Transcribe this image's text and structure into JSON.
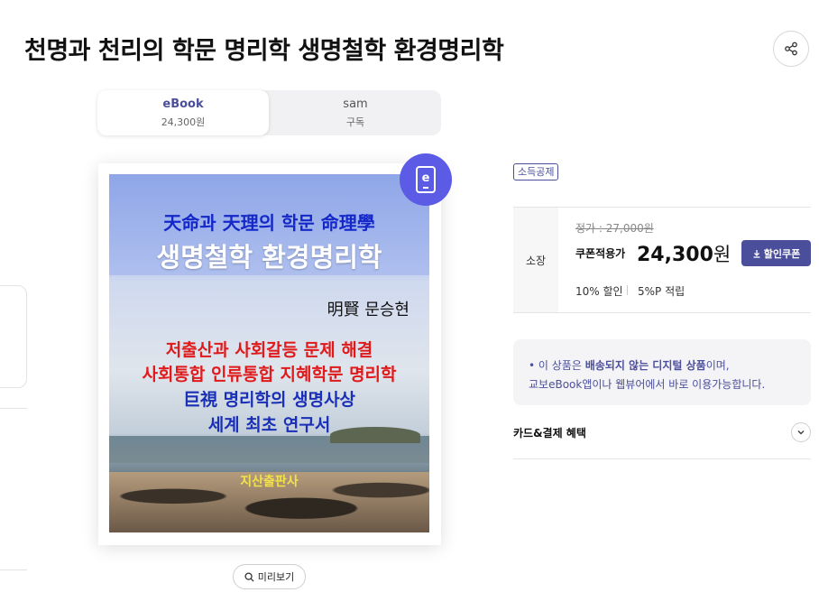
{
  "title": "천명과 천리의 학문 명리학 생명철학 환경명리학",
  "tabs": [
    {
      "name": "eBook",
      "sub": "24,300원"
    },
    {
      "name": "sam",
      "sub": "구독"
    }
  ],
  "cover": {
    "line1": "天命과 天理의 학문 命理學",
    "line2": "생명철학 환경명리학",
    "author": "明賢 문승현",
    "line4": "저출산과 사회갈등 문제 해결",
    "line5": "사회통합 인류통합 지혜학문 명리학",
    "line6": "巨視 명리학의 생명사상",
    "line7": "세계 최초 연구서",
    "publisher": "지산출판사",
    "badge_letter": "e"
  },
  "preview_label": "미리보기",
  "deduction_badge": "소득공제",
  "price": {
    "row_label": "소장",
    "list_price": "정가 : 27,000원",
    "coupon_label": "쿠폰적용가",
    "sale_amount": "24,300",
    "sale_unit": "원",
    "coupon_button": "할인쿠폰",
    "discount": "10% 할인",
    "points": "5%P 적립"
  },
  "notice": {
    "prefix": "이 상품은 ",
    "highlight": "배송되지 않는 디지털 상품",
    "suffix": "이며,",
    "line2": "교보eBook앱이나 웹뷰어에서 바로 이용가능합니다."
  },
  "card_benefit_label": "카드&결제 혜택",
  "icons": {
    "share": "share-icon",
    "search": "search-icon",
    "download": "download-icon",
    "chevron": "chevron-down-icon",
    "ebook": "ebook-badge-icon"
  },
  "colors": {
    "accent": "#4b4f9b",
    "ebook_badge": "#5b5be6"
  }
}
